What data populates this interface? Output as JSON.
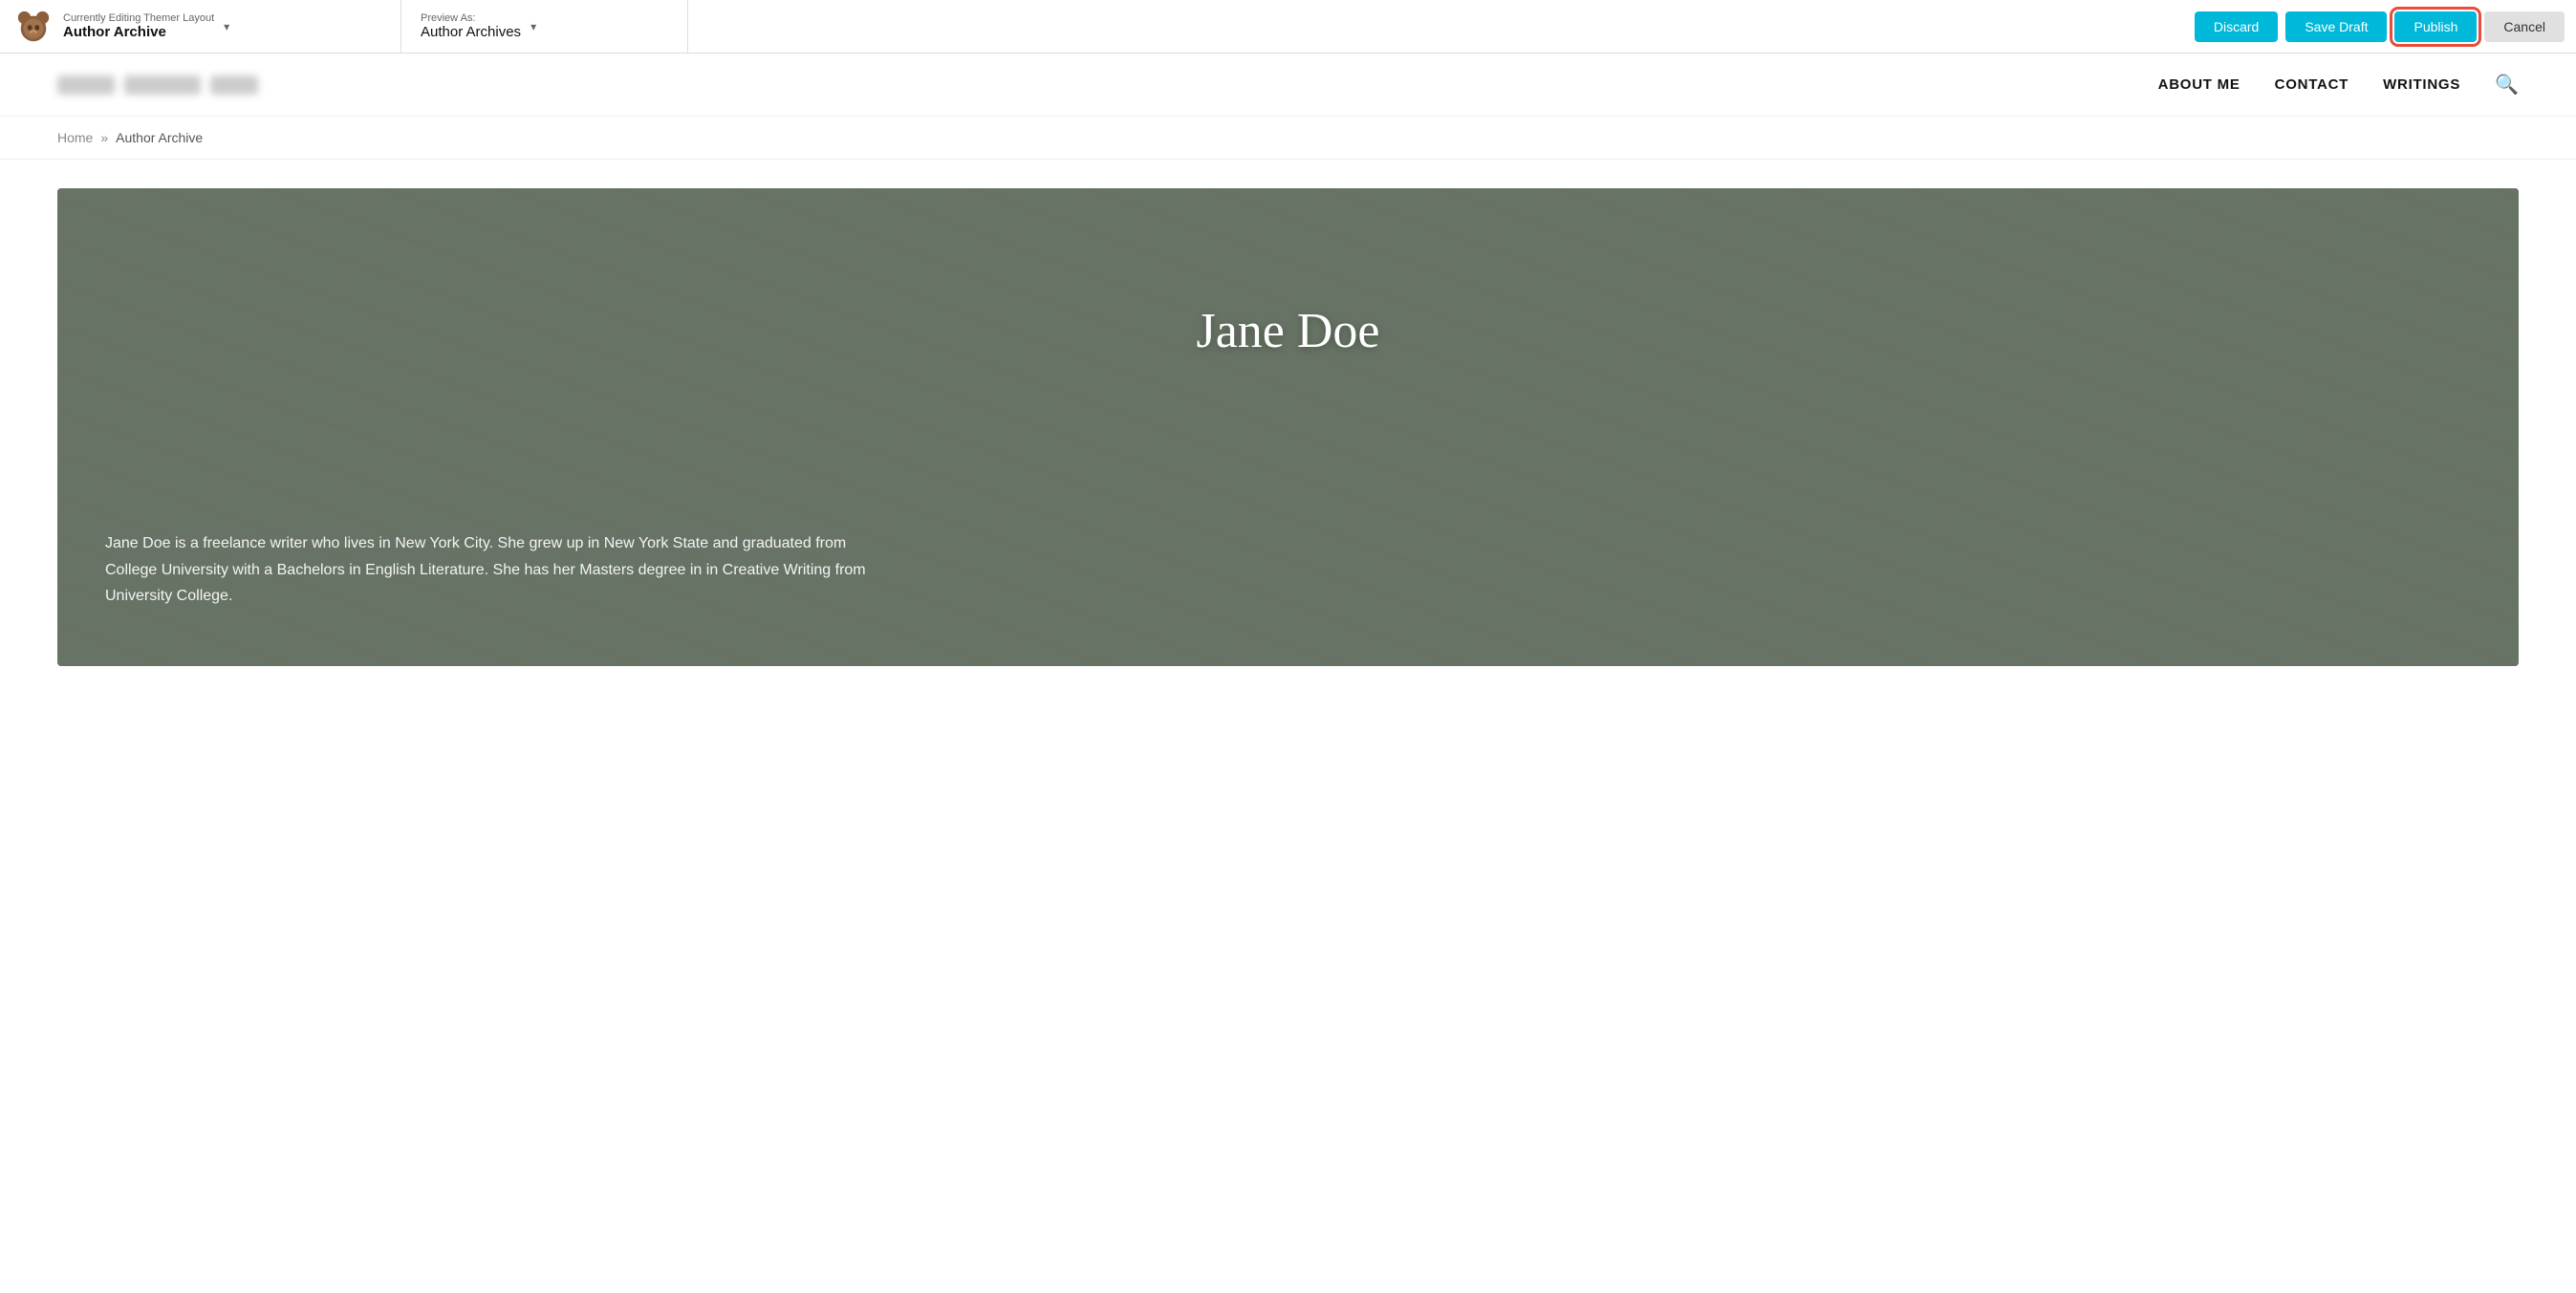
{
  "toolbar": {
    "logo_alt": "Themer Logo",
    "editing_label": "Currently Editing Themer Layout",
    "editing_title": "Author Archive",
    "preview_label": "Preview As:",
    "preview_title": "Author Archives",
    "discard_label": "Discard",
    "save_draft_label": "Save Draft",
    "publish_label": "Publish",
    "cancel_label": "Cancel"
  },
  "site_header": {
    "nav_items": [
      {
        "label": "ABOUT ME"
      },
      {
        "label": "CONTACT"
      },
      {
        "label": "WRITINGS"
      }
    ],
    "search_icon": "🔍"
  },
  "breadcrumb": {
    "home": "Home",
    "separator": "»",
    "current": "Author Archive"
  },
  "hero": {
    "name": "Jane Doe",
    "bio": "Jane Doe is a freelance writer who lives in New York City. She grew up in New York State and graduated from College University with a Bachelors in English Literature. She has her Masters degree in in Creative Writing from University College."
  }
}
